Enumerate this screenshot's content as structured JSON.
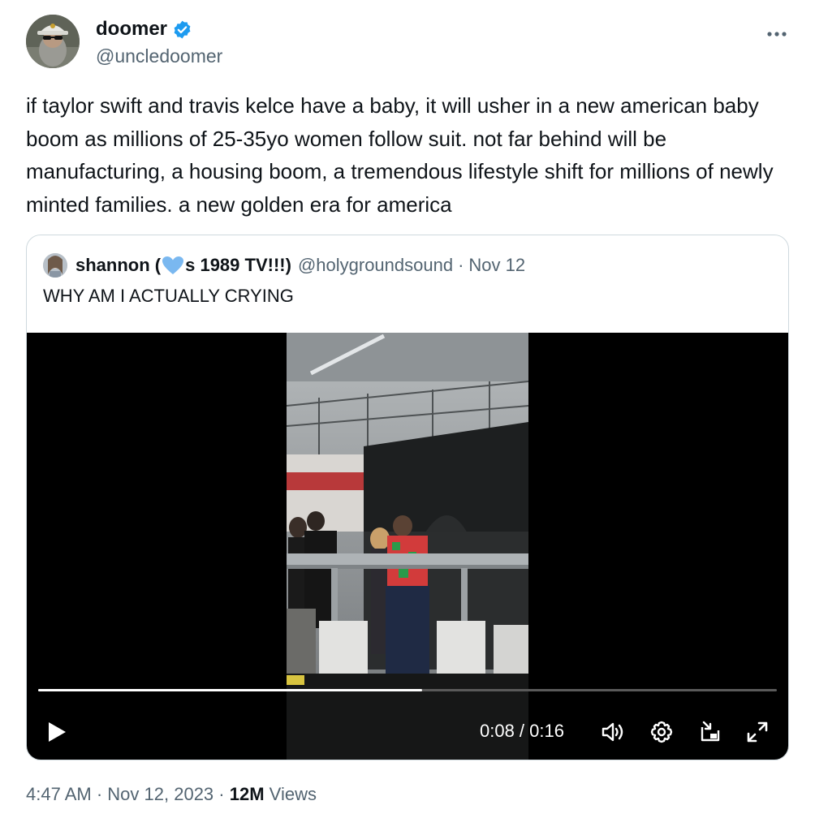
{
  "author": {
    "name": "doomer",
    "handle": "@uncledoomer",
    "verified": true,
    "verified_color": "#1d9bf0"
  },
  "menu_icon": "more-horizontal-icon",
  "tweet_text": "if taylor swift and travis kelce have a baby, it will usher in a new american baby boom as millions of 25-35yo women follow suit. not far behind will be manufacturing, a housing boom, a tremendous lifestyle shift for millions of newly minted families. a new golden era for america",
  "quote": {
    "name_prefix": "shannon (",
    "name_suffix": "s 1989 TV!!!)",
    "heart_color": "#7ab8f0",
    "handle": "@holygroundsound",
    "separator": "·",
    "date": "Nov 12",
    "text": "WHY AM I ACTUALLY CRYING"
  },
  "video": {
    "current_time": "0:08",
    "duration": "0:16",
    "time_display": "0:08 / 0:16",
    "progress": 0.52,
    "controls": [
      "play-icon",
      "volume-icon",
      "settings-gear-icon",
      "picture-in-picture-icon",
      "fullscreen-icon"
    ]
  },
  "footer": {
    "time": "4:47 AM",
    "separator": "·",
    "date": "Nov 12, 2023",
    "views_count": "12M",
    "views_label": "Views"
  },
  "colors": {
    "text_primary": "#0f1419",
    "text_secondary": "#536471",
    "border": "#cfd9de"
  }
}
